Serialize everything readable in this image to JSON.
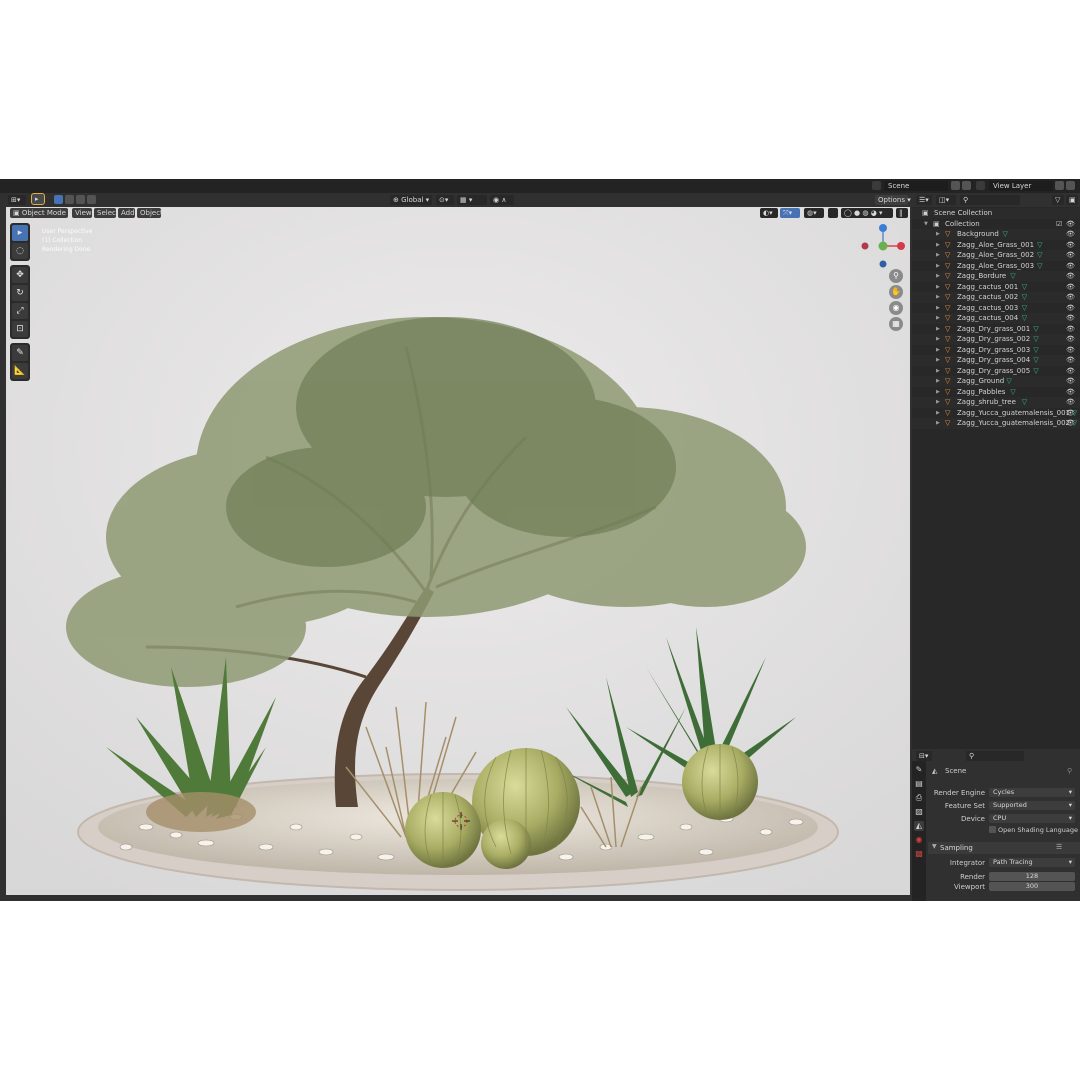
{
  "topbar": {
    "scene_label": "Scene",
    "view_layer_label": "View Layer"
  },
  "viewport_header": {
    "transform_orientation": "Global",
    "options_label": "Options",
    "mode": "Object Mode",
    "menus": [
      "View",
      "Select",
      "Add",
      "Object"
    ]
  },
  "viewport": {
    "info_lines": [
      "User Perspective",
      "(1) Collection",
      "Rendering Done"
    ],
    "gizmo_labels": {
      "z": "Z",
      "y": "Y",
      "x": "X"
    }
  },
  "outliner": {
    "root": "Scene Collection",
    "collection": "Collection",
    "items": [
      {
        "name": "Background"
      },
      {
        "name": "Zagg_Aloe_Grass_001"
      },
      {
        "name": "Zagg_Aloe_Grass_002"
      },
      {
        "name": "Zagg_Aloe_Grass_003"
      },
      {
        "name": "Zagg_Bordure"
      },
      {
        "name": "Zagg_cactus_001"
      },
      {
        "name": "Zagg_cactus_002"
      },
      {
        "name": "Zagg_cactus_003"
      },
      {
        "name": "Zagg_cactus_004"
      },
      {
        "name": "Zagg_Dry_grass_001"
      },
      {
        "name": "Zagg_Dry_grass_002"
      },
      {
        "name": "Zagg_Dry_grass_003"
      },
      {
        "name": "Zagg_Dry_grass_004"
      },
      {
        "name": "Zagg_Dry_grass_005"
      },
      {
        "name": "Zagg_Ground"
      },
      {
        "name": "Zagg_Pabbles"
      },
      {
        "name": "Zagg_shrub_tree"
      },
      {
        "name": "Zagg_Yucca_guatemalensis_001"
      },
      {
        "name": "Zagg_Yucca_guatemalensis_002"
      }
    ]
  },
  "properties": {
    "context": "Scene",
    "render_engine": {
      "label": "Render Engine",
      "value": "Cycles"
    },
    "feature_set": {
      "label": "Feature Set",
      "value": "Supported"
    },
    "device": {
      "label": "Device",
      "value": "CPU"
    },
    "osl_label": "Open Shading Language",
    "sampling": {
      "title": "Sampling",
      "integrator": {
        "label": "Integrator",
        "value": "Path Tracing"
      },
      "render": {
        "label": "Render",
        "value": "128"
      },
      "viewport": {
        "label": "Viewport",
        "value": "300"
      }
    }
  }
}
